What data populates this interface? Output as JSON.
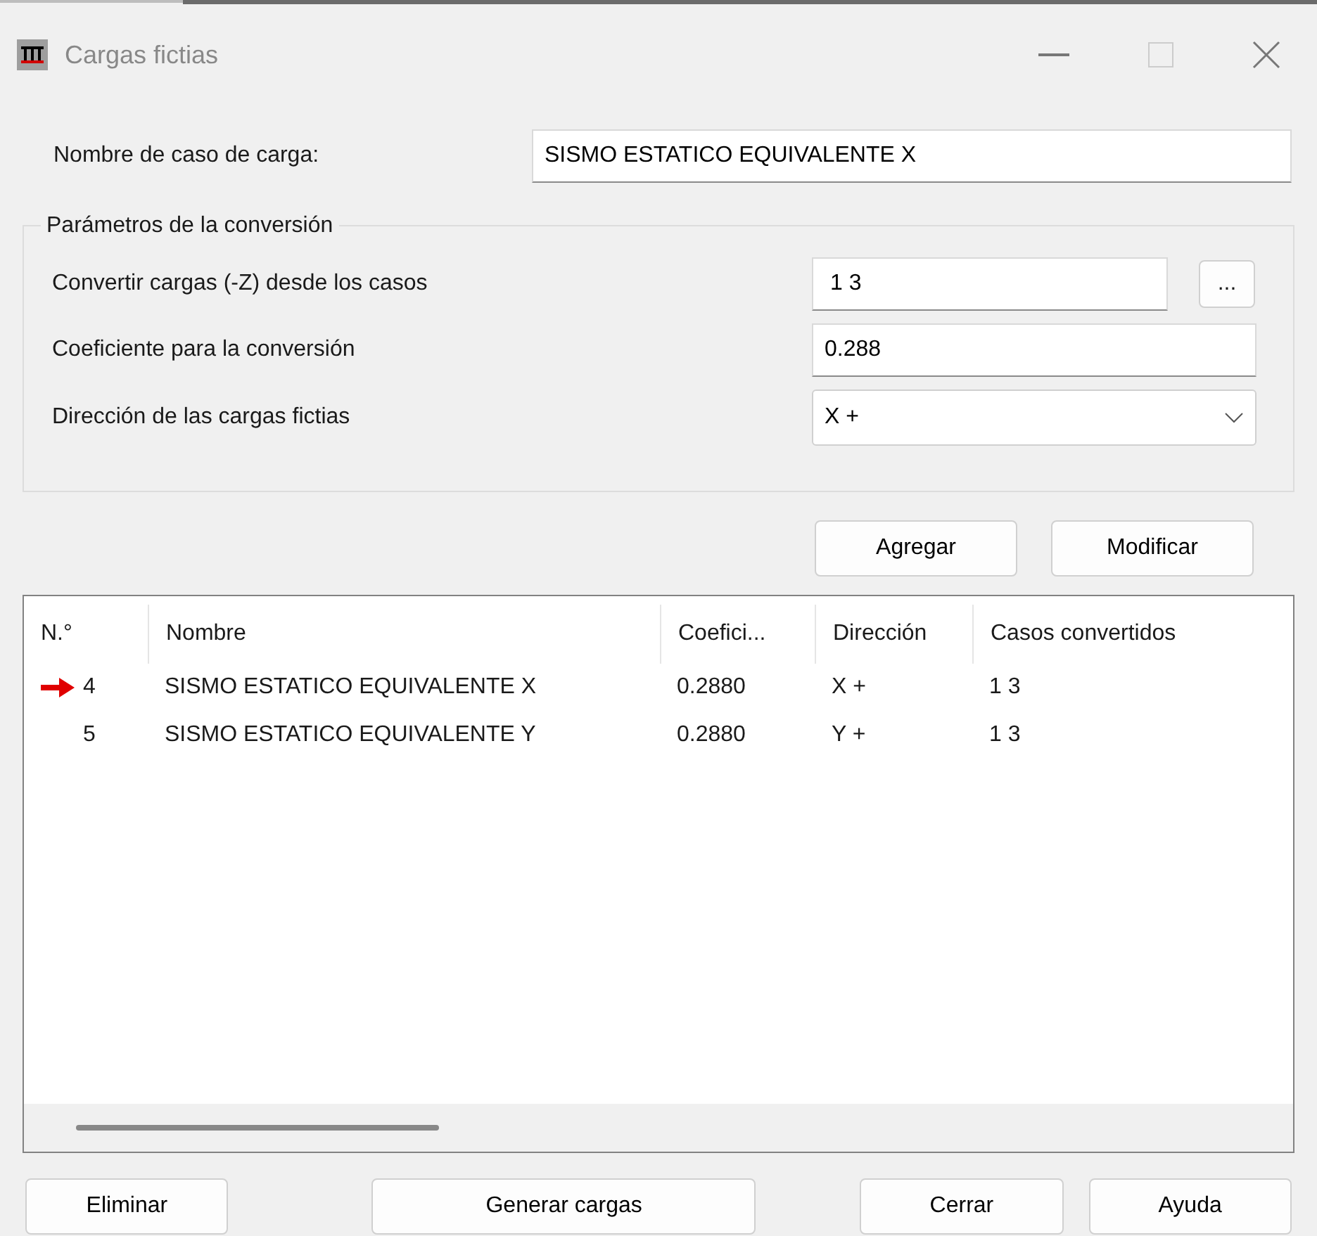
{
  "window": {
    "title": "Cargas fictias"
  },
  "load_case_name": {
    "label": "Nombre de caso de carga:",
    "value": "SISMO ESTATICO EQUIVALENTE X"
  },
  "parameters": {
    "title": "Parámetros de la conversión",
    "cases": {
      "label": "Convertir cargas (-Z) desde los casos",
      "value": "1 3",
      "browse": "..."
    },
    "coefficient": {
      "label": "Coeficiente para la conversión",
      "value": "0.288"
    },
    "direction": {
      "label": "Dirección de las cargas fictias",
      "value": "X +"
    }
  },
  "actions": [
    "Agregar",
    "Modificar"
  ],
  "table": {
    "columns": [
      "N.°",
      "Nombre",
      "Coefici...",
      "Dirección",
      "Casos convertidos"
    ],
    "rows": [
      {
        "current": true,
        "cells": [
          "4",
          "SISMO ESTATICO EQUIVALENTE X",
          "0.2880",
          "X +",
          "1 3"
        ]
      },
      {
        "current": false,
        "cells": [
          "5",
          "SISMO ESTATICO EQUIVALENTE Y",
          "0.2880",
          "Y +",
          "1 3"
        ]
      }
    ]
  },
  "buttons": [
    "Eliminar",
    "Generar cargas",
    "Cerrar",
    "Ayuda"
  ]
}
